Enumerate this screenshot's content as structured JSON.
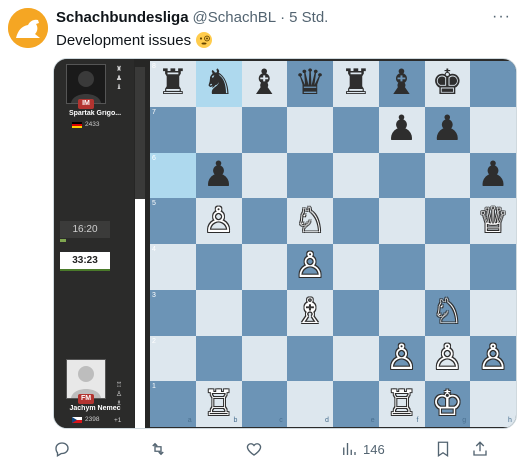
{
  "tweet": {
    "author": "Schachbundesliga",
    "handle": "@SchachBL",
    "separator": "·",
    "time": "5 Std.",
    "text": "Development issues",
    "emoji": "monocle-face-emoji",
    "more_label": "···"
  },
  "game": {
    "top_player": {
      "title": "IM",
      "name": "Spartak Grigo...",
      "rating": "2433",
      "flag": "germany-flag",
      "clock": "16:20"
    },
    "bottom_player": {
      "title": "FM",
      "name": "Jachym Nemec",
      "rating": "2398",
      "flag": "czech-flag",
      "clock": "33:23",
      "extra": "+1"
    },
    "board": {
      "ranks": [
        "8",
        "7",
        "6",
        "5",
        "4",
        "3",
        "2",
        "1"
      ],
      "files": [
        "a",
        "b",
        "c",
        "d",
        "e",
        "f",
        "g",
        "h"
      ],
      "highlighted": [
        "b8",
        "a6"
      ],
      "pieces": [
        {
          "sq": "a8",
          "glyph": "♜",
          "color": "b"
        },
        {
          "sq": "b8",
          "glyph": "♞",
          "color": "b"
        },
        {
          "sq": "c8",
          "glyph": "♝",
          "color": "b"
        },
        {
          "sq": "d8",
          "glyph": "♛",
          "color": "b"
        },
        {
          "sq": "e8",
          "glyph": "♜",
          "color": "b"
        },
        {
          "sq": "f8",
          "glyph": "♝",
          "color": "b"
        },
        {
          "sq": "g8",
          "glyph": "♚",
          "color": "b"
        },
        {
          "sq": "f7",
          "glyph": "♟",
          "color": "b"
        },
        {
          "sq": "g7",
          "glyph": "♟",
          "color": "b"
        },
        {
          "sq": "b6",
          "glyph": "♟",
          "color": "b"
        },
        {
          "sq": "h6",
          "glyph": "♟",
          "color": "b"
        },
        {
          "sq": "b5",
          "glyph": "♙",
          "color": "w"
        },
        {
          "sq": "d5",
          "glyph": "♘",
          "color": "w"
        },
        {
          "sq": "h5",
          "glyph": "♕",
          "color": "w"
        },
        {
          "sq": "d4",
          "glyph": "♙",
          "color": "w"
        },
        {
          "sq": "d3",
          "glyph": "♗",
          "color": "w"
        },
        {
          "sq": "g3",
          "glyph": "♘",
          "color": "w"
        },
        {
          "sq": "f2",
          "glyph": "♙",
          "color": "w"
        },
        {
          "sq": "g2",
          "glyph": "♙",
          "color": "w"
        },
        {
          "sq": "h2",
          "glyph": "♙",
          "color": "w"
        },
        {
          "sq": "b1",
          "glyph": "♖",
          "color": "w"
        },
        {
          "sq": "f1",
          "glyph": "♖",
          "color": "w"
        },
        {
          "sq": "g1",
          "glyph": "♔",
          "color": "w"
        }
      ]
    }
  },
  "actions": {
    "reply_icon": "reply-icon",
    "retweet_icon": "retweet-icon",
    "like_icon": "heart-icon",
    "views_icon": "views-icon",
    "views_count": "146",
    "bookmark_icon": "bookmark-icon",
    "share_icon": "share-icon"
  },
  "colors": {
    "accent": "#f5a623",
    "board_light": "#dde7ee",
    "board_dark": "#6c94b6",
    "highlight": "#aed9ee"
  }
}
